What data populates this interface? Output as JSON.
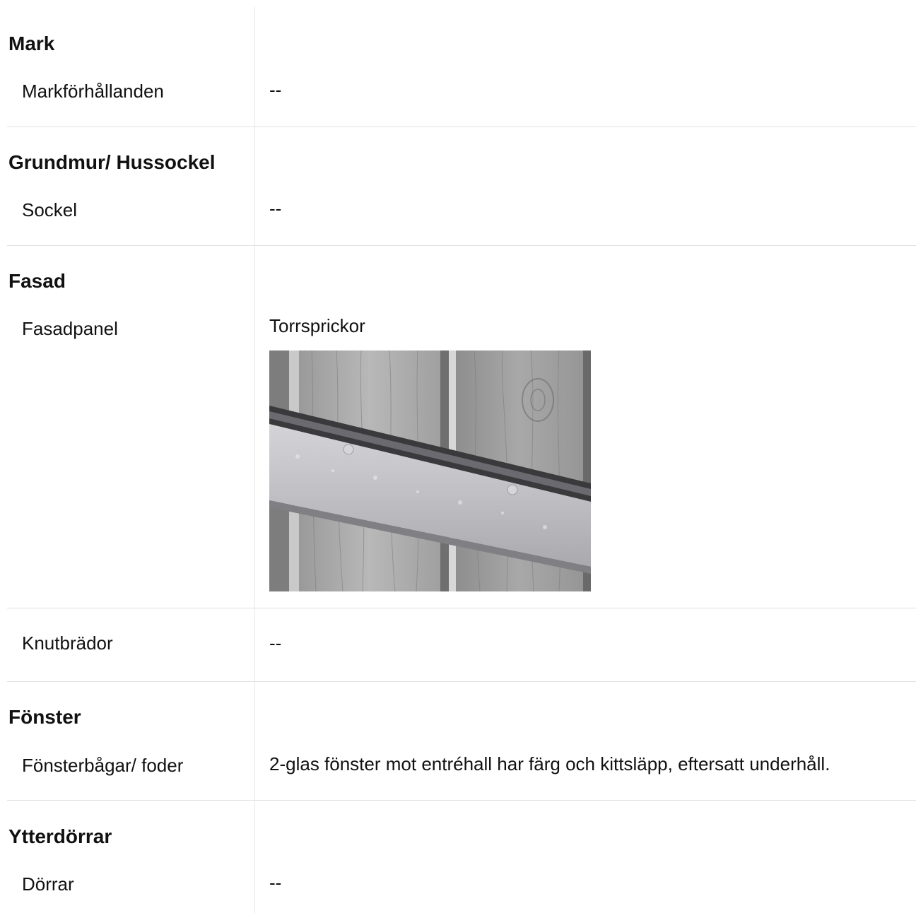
{
  "sections": [
    {
      "heading": "Mark",
      "items": [
        {
          "label": "Markförhållanden",
          "value": "--"
        }
      ]
    },
    {
      "heading": "Grundmur/ Hussockel",
      "items": [
        {
          "label": "Sockel",
          "value": "--"
        }
      ]
    },
    {
      "heading": "Fasad",
      "items": [
        {
          "label": "Fasadpanel",
          "value": "Torrsprickor",
          "photo": "weathered-wood-panel-photo"
        },
        {
          "label": "Knutbrädor",
          "value": "--"
        }
      ]
    },
    {
      "heading": "Fönster",
      "items": [
        {
          "label": "Fönsterbågar/ foder",
          "value": "2-glas fönster mot entréhall har färg och kittsläpp, eftersatt underhåll."
        }
      ]
    },
    {
      "heading": "Ytterdörrar",
      "items": [
        {
          "label": "Dörrar",
          "value": "--"
        }
      ]
    }
  ],
  "colors": {
    "text": "#111111",
    "divider": "#e0e0e0",
    "background": "#ffffff"
  }
}
